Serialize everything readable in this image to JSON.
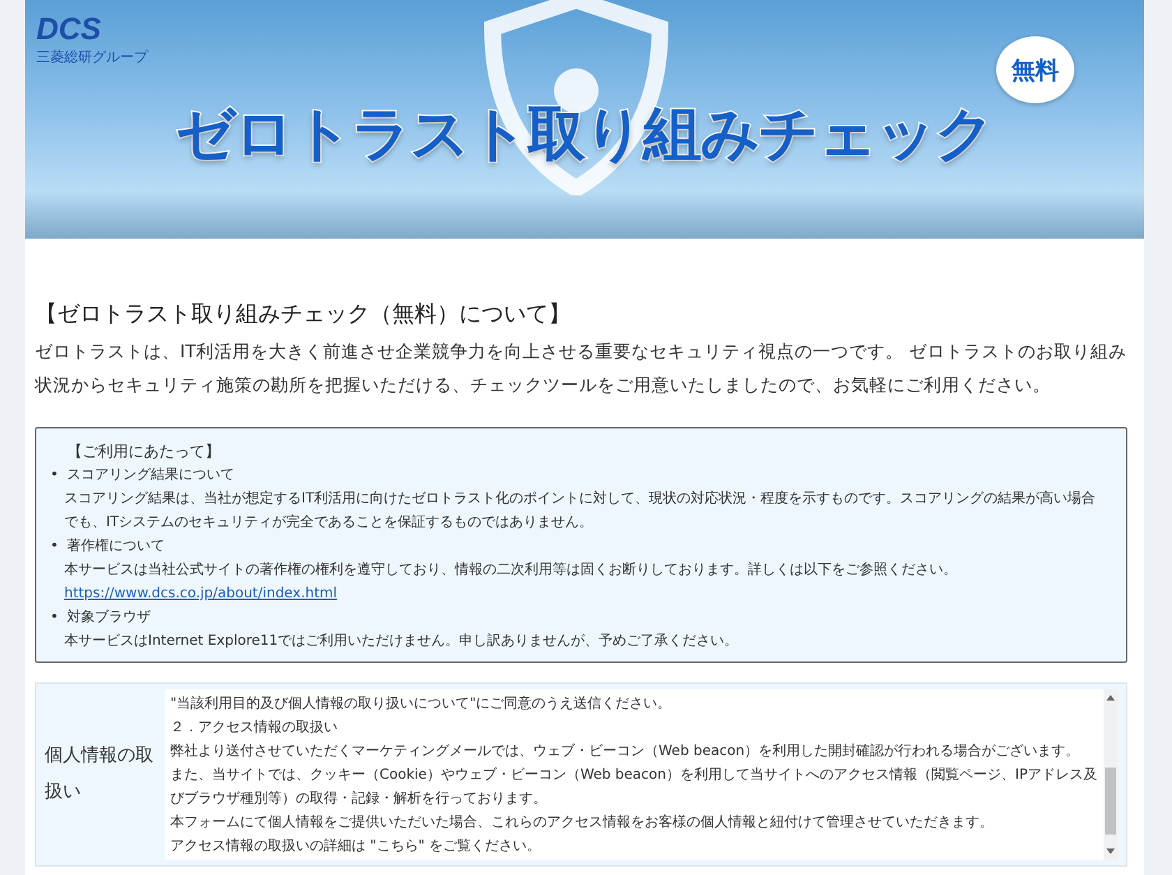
{
  "banner": {
    "logo": "DCS",
    "logo_caption": "三菱総研グループ",
    "title": "ゼロトラスト取り組みチェック",
    "badge": "無料"
  },
  "about": {
    "heading": "【ゼロトラスト取り組みチェック（無料）について】",
    "intro": "ゼロトラストは、IT利活用を大きく前進させ企業競争力を向上させる重要なセキュリティ視点の一つです。 ゼロトラストのお取り組み状況からセキュリティ施策の勘所を把握いただける、チェックツールをご用意いたしましたので、お気軽にご利用ください。"
  },
  "notice": {
    "heading": "【ご利用にあたって】",
    "items": [
      {
        "bullet": "•",
        "title": "スコアリング結果について",
        "body": "スコアリング結果は、当社が想定するIT利活用に向けたゼロトラスト化のポイントに対して、現状の対応状況・程度を示すものです。スコアリングの結果が高い場合でも、ITシステムのセキュリティが完全であることを保証するものではありません。"
      },
      {
        "bullet": "•",
        "title": "著作権について",
        "body": "本サービスは当社公式サイトの著作権の権利を遵守しており、情報の二次利用等は固くお断りしております。詳しくは以下をご参照ください。",
        "link": "https://www.dcs.co.jp/about/index.html"
      },
      {
        "bullet": "•",
        "title": "対象ブラウザ",
        "body": "本サービスはInternet Explore11ではご利用いただけません。申し訳ありませんが、予めご了承ください。"
      }
    ]
  },
  "privacy": {
    "label": "個人情報の取扱い",
    "lines": [
      "\"当該利用目的及び個人情報の取り扱いについて\"にご同意のうえ送信ください。",
      "２．アクセス情報の取扱い",
      "弊社より送付させていただくマーケティングメールでは、ウェブ・ビーコン（Web beacon）を利用した開封確認が行われる場合がございます。",
      "また、当サイトでは、クッキー（Cookie）やウェブ・ビーコン（Web beacon）を利用して当サイトへのアクセス情報（閲覧ページ、IPアドレス及びブラウザ種別等）の取得・記録・解析を行っております。",
      "本フォームにて個人情報をご提供いただいた場合、これらのアクセス情報をお客様の個人情報と紐付けて管理させていただきます。",
      "アクセス情報の取扱いの詳細は \"こちら\" をご覧ください。"
    ]
  }
}
